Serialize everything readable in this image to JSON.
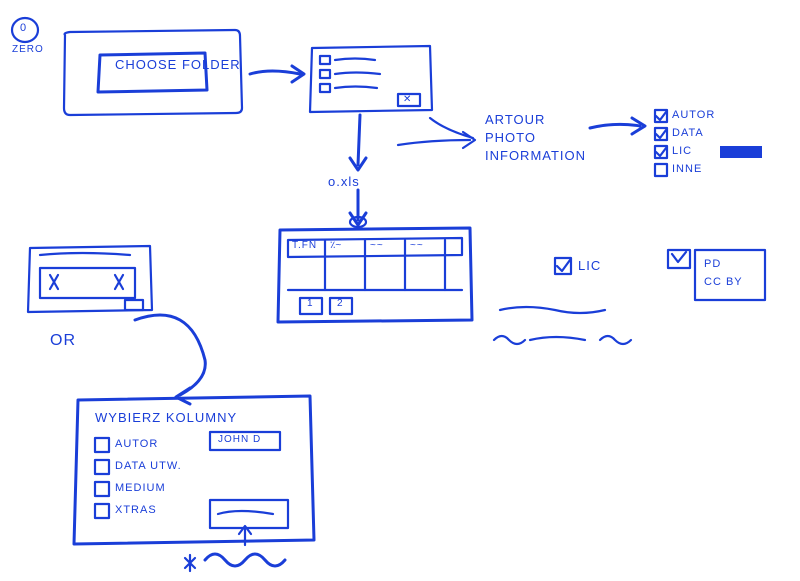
{
  "step_marker": {
    "digit": "0",
    "word": "ZERO"
  },
  "choose_folder": {
    "button_label": "CHOOSE FOLDER"
  },
  "file_list_popup": {
    "ok_button": "✕"
  },
  "xls_label": "o.xls",
  "photo_info_block": {
    "line1": "ARTOUR",
    "line2": "PHOTO",
    "line3": "INFORMATION"
  },
  "field_checklist": {
    "items": [
      {
        "label": "AUTOR",
        "checked": true
      },
      {
        "label": "DATA",
        "checked": true
      },
      {
        "label": "LIC",
        "checked": true
      },
      {
        "label": "INNE",
        "checked": false
      }
    ]
  },
  "spreadsheet": {
    "col1": "T.FN",
    "pager": [
      "1",
      "2"
    ]
  },
  "lic_checkbox": "LIC",
  "lic_options": {
    "opt1": "PD",
    "opt2": "CC BY"
  },
  "or_label": "OR",
  "column_dialog": {
    "title": "WYBIERZ  KOLUMNY",
    "example_value": "JOHN D",
    "rows": [
      "AUTOR",
      "DATA UTW.",
      "MEDIUM",
      "XTRAS"
    ]
  }
}
